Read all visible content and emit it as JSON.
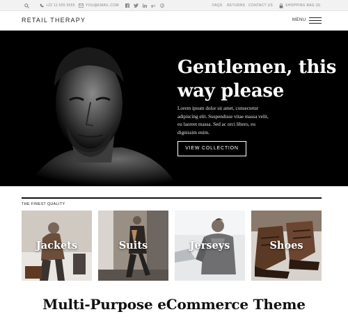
{
  "topbar": {
    "phone": "+22 11 555 5555",
    "email": "YOU@EMAIL.COM",
    "social": [
      "facebook-icon",
      "twitter-icon",
      "linkedin-icon",
      "google-plus-icon",
      "pinterest-icon"
    ],
    "links": [
      "FAQS",
      "RETURNS",
      "CONTACT US"
    ],
    "bag": "SHOPPING BAG (0)"
  },
  "header": {
    "logo": "RETAIL THERAPY",
    "menu": "MENU"
  },
  "hero": {
    "title_line1": "Gentlemen, this",
    "title_line2": "way please",
    "body_line1": "Lorem ipsum dolor sit amet, consectetur",
    "body_line2": "adipiscing elit. Suspendisse vitae massa velit,",
    "body_line3": "eu laoreet massa. Sed ac orci libero, eu",
    "body_line4": "dignissim enim.",
    "button": "VIEW COLLECTION",
    "bg_color": "#000000"
  },
  "quality": {
    "title": "THE FINEST QUALITY",
    "categories": [
      {
        "label": "Jackets"
      },
      {
        "label": "Suits"
      },
      {
        "label": "Jerseys"
      },
      {
        "label": "Shoes"
      }
    ]
  },
  "footer_title": "Multi-Purpose eCommerce Theme"
}
